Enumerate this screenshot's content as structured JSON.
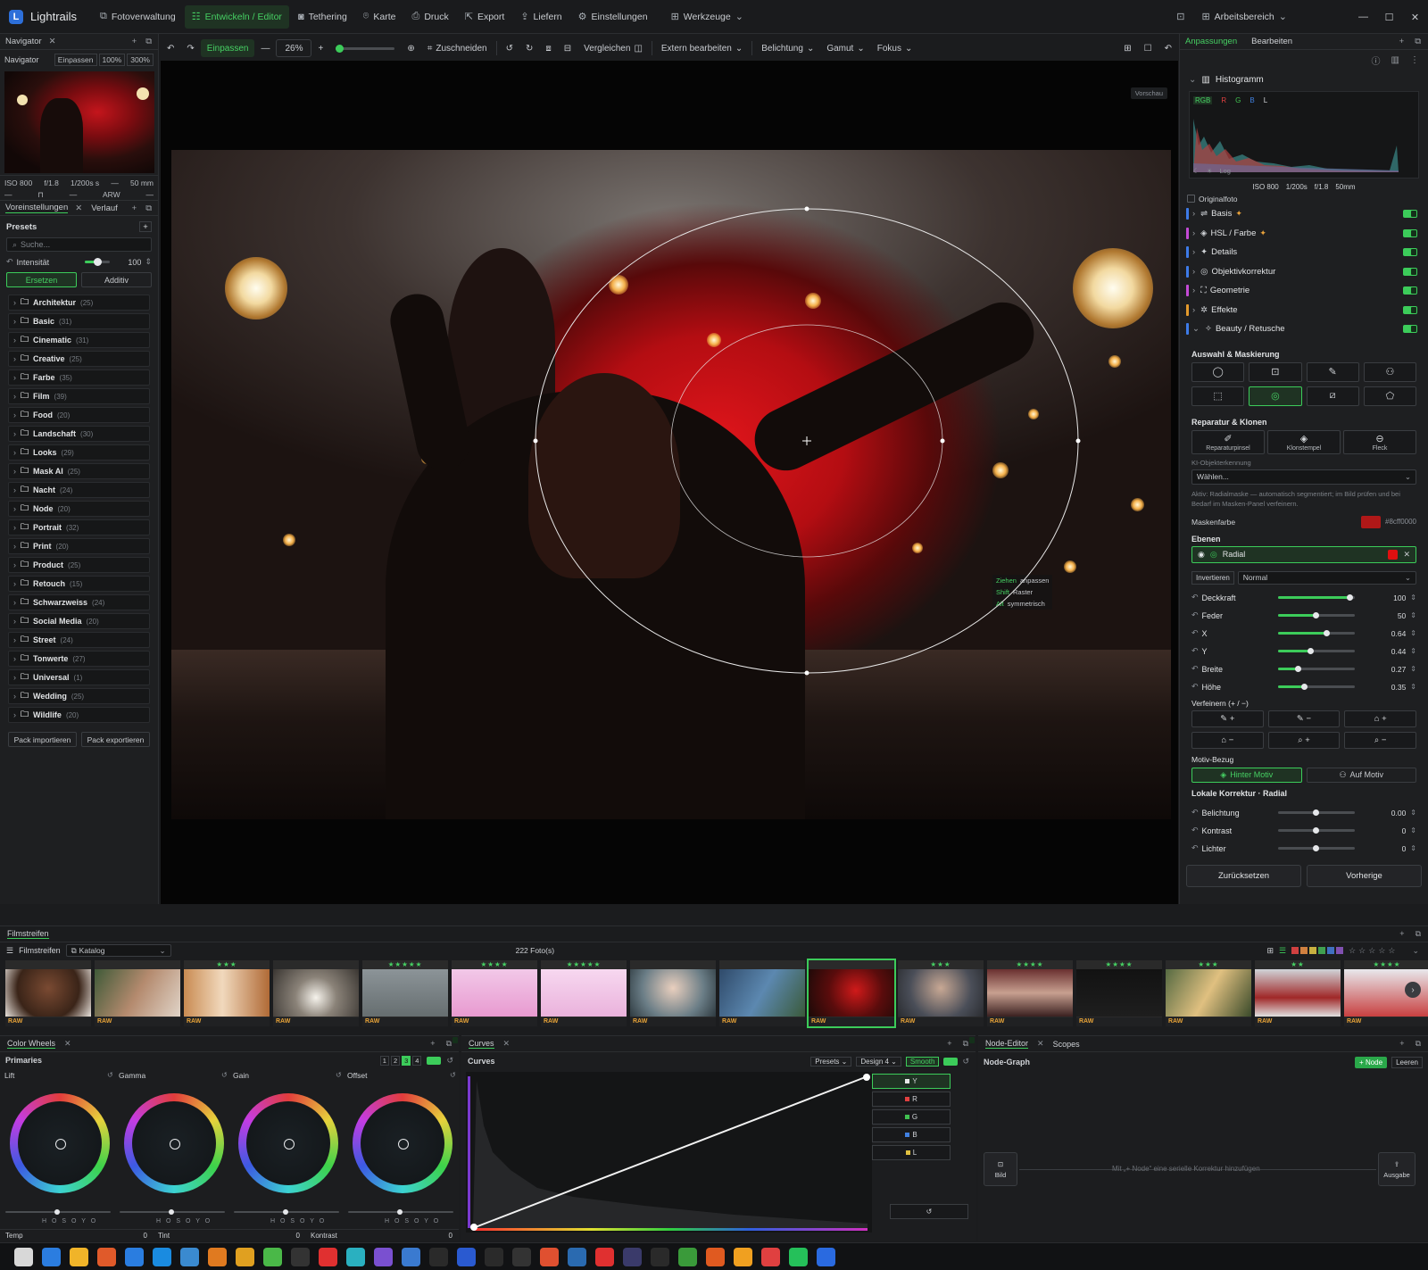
{
  "app": {
    "name": "Lightrails"
  },
  "topnav": [
    {
      "label": "Fotoverwaltung",
      "icon": "library-icon",
      "active": false
    },
    {
      "label": "Entwickeln / Editor",
      "icon": "sliders-icon",
      "active": true
    },
    {
      "label": "Tethering",
      "icon": "camera-icon",
      "active": false
    },
    {
      "label": "Karte",
      "icon": "map-pin-icon",
      "active": false
    },
    {
      "label": "Druck",
      "icon": "printer-icon",
      "active": false
    },
    {
      "label": "Export",
      "icon": "export-icon",
      "active": false
    },
    {
      "label": "Liefern",
      "icon": "upload-icon",
      "active": false
    },
    {
      "label": "Einstellungen",
      "icon": "gear-icon",
      "active": false
    },
    {
      "label": "Werkzeuge",
      "icon": "grid-icon",
      "active": false
    }
  ],
  "workspace": {
    "label": "Arbeitsbereich"
  },
  "toolbar": {
    "fit": "Einpassen",
    "zoom": "26%",
    "crop": "Zuschneiden",
    "compare": "Vergleichen",
    "extern": "Extern bearbeiten",
    "exposure": "Belichtung",
    "gamut": "Gamut",
    "focus": "Fokus"
  },
  "navigator": {
    "tab": "Navigator",
    "title": "Navigator",
    "btn_fit": "Einpassen",
    "btn_100": "100%",
    "btn_300": "300%",
    "iso": "ISO 800",
    "aperture": "f/1.8",
    "shutter": "1/200s s",
    "dash": "—",
    "focal": "50 mm",
    "row2": [
      "—",
      "⊓",
      "—",
      "ARW",
      "—"
    ]
  },
  "presets": {
    "tab1": "Voreinstellungen",
    "tab2": "Verlauf",
    "title": "Presets",
    "search": "Suche...",
    "intensity_label": "Intensität",
    "intensity_value": "100",
    "intensity": 100,
    "mode_replace": "Ersetzen",
    "mode_add": "Additiv",
    "items": [
      {
        "name": "Architektur",
        "count": "(25)"
      },
      {
        "name": "Basic",
        "count": "(31)"
      },
      {
        "name": "Cinematic",
        "count": "(31)"
      },
      {
        "name": "Creative",
        "count": "(25)"
      },
      {
        "name": "Farbe",
        "count": "(35)"
      },
      {
        "name": "Film",
        "count": "(39)"
      },
      {
        "name": "Food",
        "count": "(20)"
      },
      {
        "name": "Landschaft",
        "count": "(30)"
      },
      {
        "name": "Looks",
        "count": "(29)"
      },
      {
        "name": "Mask AI",
        "count": "(25)"
      },
      {
        "name": "Nacht",
        "count": "(24)"
      },
      {
        "name": "Node",
        "count": "(20)"
      },
      {
        "name": "Portrait",
        "count": "(32)"
      },
      {
        "name": "Print",
        "count": "(20)"
      },
      {
        "name": "Product",
        "count": "(25)"
      },
      {
        "name": "Retouch",
        "count": "(15)"
      },
      {
        "name": "Schwarzweiss",
        "count": "(24)"
      },
      {
        "name": "Social Media",
        "count": "(20)"
      },
      {
        "name": "Street",
        "count": "(24)"
      },
      {
        "name": "Tonwerte",
        "count": "(27)"
      },
      {
        "name": "Universal",
        "count": "(1)"
      },
      {
        "name": "Wedding",
        "count": "(25)"
      },
      {
        "name": "Wildlife",
        "count": "(20)"
      }
    ],
    "import": "Pack importieren",
    "export": "Pack exportieren"
  },
  "canvas": {
    "preview": "Vorschau",
    "hint": [
      {
        "key": "Ziehen",
        "text": "anpassen"
      },
      {
        "key": "Shift",
        "text": "Raster"
      },
      {
        "key": "Alt",
        "text": "symmetrisch"
      }
    ]
  },
  "right": {
    "tab1": "Anpassungen",
    "tab2": "Bearbeiten",
    "histogram": "Histogramm",
    "hist_tabs": [
      "RGB",
      "R",
      "G",
      "B",
      "L"
    ],
    "hist_log": "Log",
    "hist_exif": [
      "ISO 800",
      "1/200s",
      "f/1.8",
      "50mm"
    ],
    "original": "Originalfoto",
    "modules": [
      {
        "label": "Basis",
        "star": true,
        "color": "#3d7be8",
        "icon": "⇌"
      },
      {
        "label": "HSL / Farbe",
        "star": true,
        "color": "#c44ad6",
        "icon": "◈"
      },
      {
        "label": "Details",
        "star": false,
        "color": "#3d7be8",
        "icon": "✦"
      },
      {
        "label": "Objektivkorrektur",
        "star": false,
        "color": "#3d7be8",
        "icon": "◎"
      },
      {
        "label": "Geometrie",
        "star": false,
        "color": "#c44ad6",
        "icon": "⛶"
      },
      {
        "label": "Effekte",
        "star": false,
        "color": "#e39a2c",
        "icon": "✲"
      },
      {
        "label": "Beauty / Retusche",
        "star": false,
        "color": "#3d7be8",
        "icon": "✧"
      }
    ],
    "mask_title": "Auswahl & Maskierung",
    "repair_title": "Reparatur & Klonen",
    "repair": [
      "Reparaturpinsel",
      "Klonstempel",
      "Fleck"
    ],
    "ai_label": "KI-Objekterkennung",
    "ai_select": "Wählen...",
    "ai_note": "Aktiv: Radialmaske — automatisch segmentiert; im Bild prüfen und bei Bedarf im Masken-Panel verfeinern.",
    "maskcolor_label": "Maskenfarbe",
    "maskcolor_value": "#8cff0000",
    "maskcolor": "#b01818",
    "layers_title": "Ebenen",
    "layer_name": "Radial",
    "invert": "Invertieren",
    "blend": "Normal",
    "params": [
      {
        "label": "Deckkraft",
        "value": "100",
        "pos": 0.95
      },
      {
        "label": "Feder",
        "value": "50",
        "pos": 0.5
      },
      {
        "label": "X",
        "value": "0.64",
        "pos": 0.64
      },
      {
        "label": "Y",
        "value": "0.44",
        "pos": 0.44
      },
      {
        "label": "Breite",
        "value": "0.27",
        "pos": 0.27
      },
      {
        "label": "Höhe",
        "value": "0.35",
        "pos": 0.35
      }
    ],
    "refine_title": "Verfeinern (+ / −)",
    "refine": [
      "✎ +",
      "✎ −",
      "⌂ +",
      "⌂ −",
      "⌕ +",
      "⌕ −"
    ],
    "motiv_title": "Motiv-Bezug",
    "motiv_behind": "Hinter Motiv",
    "motiv_on": "Auf Motiv",
    "local_title": "Lokale Korrektur · Radial",
    "local": [
      {
        "label": "Belichtung",
        "value": "0.00"
      },
      {
        "label": "Kontrast",
        "value": "0"
      },
      {
        "label": "Lichter",
        "value": "0"
      }
    ],
    "reset": "Zurücksetzen",
    "prev": "Vorherige"
  },
  "filmstrip": {
    "tab": "Filmstreifen",
    "title": "Filmstreifen",
    "catalog": "Katalog",
    "count": "222 Foto(s)",
    "thumbs": [
      {
        "stars": "",
        "g": "radial-gradient(circle at 50% 40%,#7a4a32,#3a2418 60%,#e8e2dc 100%)"
      },
      {
        "stars": "",
        "g": "linear-gradient(120deg,#3f5a38,#b48a6e 50%,#e0d4c8)"
      },
      {
        "stars": "★★★",
        "g": "linear-gradient(90deg,#c98b52,#f1d9bd 45%,#b06a36)"
      },
      {
        "stars": "",
        "g": "radial-gradient(circle at 50% 60%,#f6f3ec,#8a8278 40%,#3a3632)"
      },
      {
        "stars": "★★★★★",
        "g": "linear-gradient(#8c9498,#666e70)"
      },
      {
        "stars": "★★★★",
        "g": "linear-gradient(#f2c8e8,#e89ad0)"
      },
      {
        "stars": "★★★★★",
        "g": "linear-gradient(#f7d8f0,#eab2dc)"
      },
      {
        "stars": "",
        "g": "radial-gradient(circle at 50% 40%,#e9cfbe,#6a7d86 60%,#2e3a40)"
      },
      {
        "stars": "",
        "g": "linear-gradient(120deg,#2f4a6a,#5c88b0 50%,#3a5a3a)"
      },
      {
        "stars": "",
        "g": "radial-gradient(circle at 55% 45%,#d01a1a,#5a0c0c 50%,#1a0a08)"
      },
      {
        "stars": "★★★",
        "g": "radial-gradient(circle at 50% 40%,#c8a894,#4a4e58 60%,#2a2c30)"
      },
      {
        "stars": "★★★★",
        "g": "linear-gradient(#6a3030,#c8a090 50%,#3a2020)"
      },
      {
        "stars": "★★★★",
        "g": "linear-gradient(#121212,#1e1e1e)"
      },
      {
        "stars": "★★★",
        "g": "linear-gradient(120deg,#566a42,#e0c080 50%,#3a4a2a)"
      },
      {
        "stars": "★★",
        "g": "linear-gradient(#d0d4d8,#a02828 60%,#e0e0e0)"
      },
      {
        "stars": "★★★★",
        "g": "linear-gradient(#e8e8ec,#c84040)"
      }
    ],
    "raw": "RAW"
  },
  "colorwheels": {
    "tab": "Color Wheels",
    "title": "Primaries",
    "labels": [
      "Lift",
      "Gamma",
      "Gain",
      "Offset"
    ],
    "hsy": "H O S O Y O",
    "temp": "Temp",
    "temp_val": "0",
    "tint": "Tint",
    "tint_val": "0",
    "contrast": "Kontrast",
    "contrast_val": "0",
    "pages": [
      "1",
      "2",
      "3",
      "4"
    ]
  },
  "curves": {
    "tab": "Curves",
    "title": "Curves",
    "presets": "Presets",
    "design": "Design 4",
    "smooth": "Smooth",
    "channels": [
      "Y",
      "R",
      "G",
      "B",
      "L"
    ],
    "channel_colors": [
      "#e8e8e8",
      "#e04040",
      "#40c050",
      "#4080e0",
      "#e0c040"
    ]
  },
  "node": {
    "tab1": "Node-Editor",
    "tab2": "Scopes",
    "title": "Node-Graph",
    "add": "+ Node",
    "clear": "Leeren",
    "input": "Bild",
    "output": "Ausgabe",
    "hint": "Mit „+ Node“ eine serielle Korrektur hinzufügen"
  }
}
